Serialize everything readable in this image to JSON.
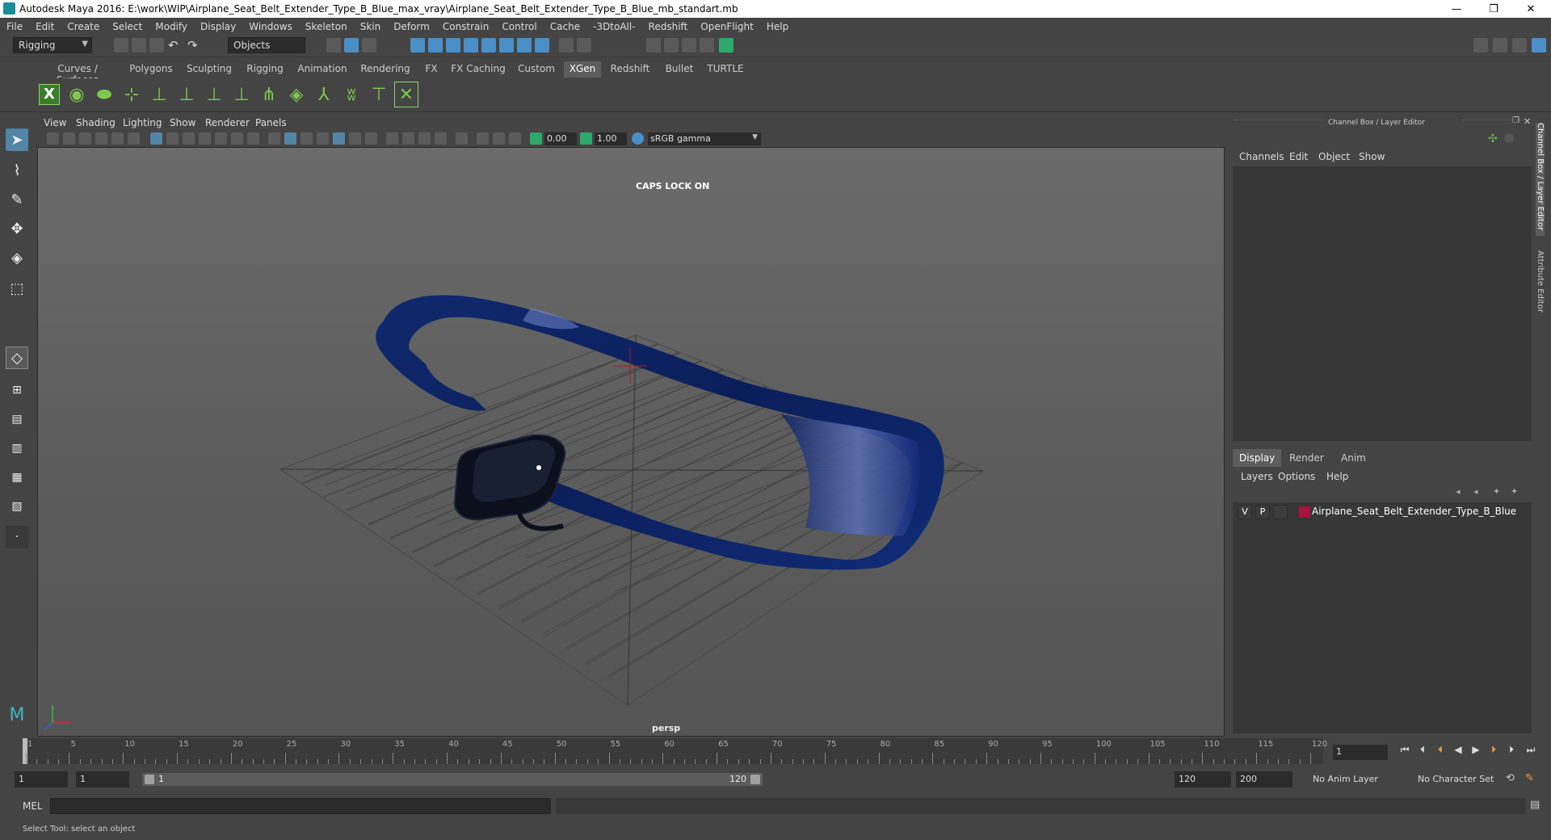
{
  "window": {
    "title": "Autodesk Maya 2016: E:\\work\\WIP\\Airplane_Seat_Belt_Extender_Type_B_Blue_max_vray\\Airplane_Seat_Belt_Extender_Type_B_Blue_mb_standart.mb",
    "minimize": "—",
    "restore": "❐",
    "close": "✕"
  },
  "menubar": [
    "File",
    "Edit",
    "Create",
    "Select",
    "Modify",
    "Display",
    "Windows",
    "Skeleton",
    "Skin",
    "Deform",
    "Constrain",
    "Control",
    "Cache",
    "-3DtoAll-",
    "Redshift",
    "OpenFlight",
    "Help"
  ],
  "statusline": {
    "menuset": "Rigging",
    "selection_mode": "Objects"
  },
  "shelf_tabs": [
    "Curves / Surfaces",
    "Polygons",
    "Sculpting",
    "Rigging",
    "Animation",
    "Rendering",
    "FX",
    "FX Caching",
    "Custom",
    "XGen",
    "Redshift",
    "Bullet",
    "TURTLE"
  ],
  "shelf_active": "XGen",
  "viewport": {
    "menu": [
      "View",
      "Shading",
      "Lighting",
      "Show",
      "Renderer",
      "Panels"
    ],
    "exposure": "0.00",
    "gamma": "1.00",
    "color_space": "sRGB gamma",
    "hud_caps": "CAPS LOCK ON",
    "camera": "persp"
  },
  "channel_box": {
    "title": "Channel Box / Layer Editor",
    "menu": [
      "Channels",
      "Edit",
      "Object",
      "Show"
    ]
  },
  "layer_editor": {
    "tabs": [
      "Display",
      "Render",
      "Anim"
    ],
    "active_tab": "Display",
    "menu": [
      "Layers",
      "Options",
      "Help"
    ],
    "layers": [
      {
        "visible": "V",
        "playback": "P",
        "name": "Airplane_Seat_Belt_Extender_Type_B_Blue",
        "color": "#a8123e"
      }
    ]
  },
  "side_tabs": [
    "Channel Box / Layer Editor",
    "Attribute Editor"
  ],
  "timeslider": {
    "labels": [
      "1",
      "5",
      "10",
      "15",
      "20",
      "25",
      "30",
      "35",
      "40",
      "45",
      "50",
      "55",
      "60",
      "65",
      "70",
      "75",
      "80",
      "85",
      "90",
      "95",
      "100",
      "105",
      "110",
      "115",
      "120"
    ],
    "current_frame": "1"
  },
  "range": {
    "start": "1",
    "playback_start": "1",
    "slider_start": "1",
    "slider_end": "120",
    "playback_end": "120",
    "end": "200",
    "anim_layer": "No Anim Layer",
    "character_set": "No Character Set"
  },
  "command_line": {
    "label": "MEL"
  },
  "help_line": "Select Tool: select an object"
}
